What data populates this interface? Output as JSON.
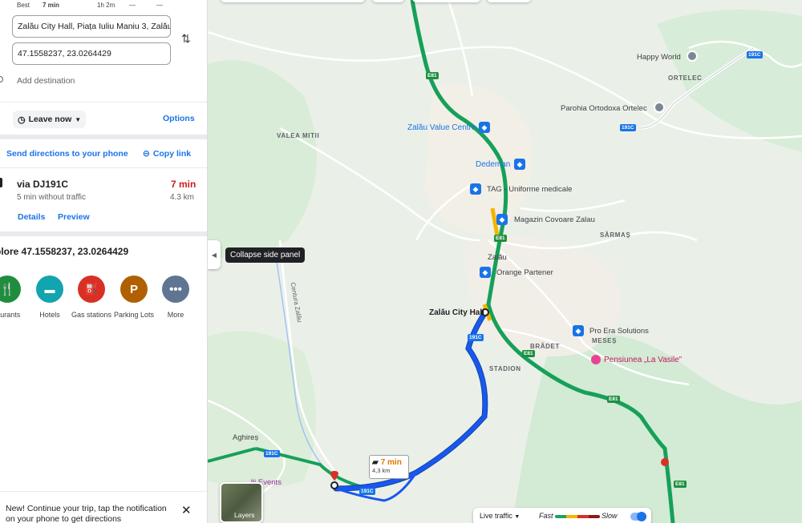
{
  "panel": {
    "modes": [
      {
        "label": "Best"
      },
      {
        "label": "7 min"
      },
      {
        "label": "1h 2m"
      },
      {
        "label": "—"
      },
      {
        "label": "—"
      }
    ],
    "origin_value": "Zalău City Hall, Piața Iuliu Maniu 3, Zalău",
    "destination_value": "47.1558237, 23.0264429",
    "add_destination": "Add destination",
    "leave_now": "Leave now",
    "options": "Options",
    "send_directions": "Send directions to your phone",
    "copy_link": "Copy link",
    "route": {
      "via": "via DJ191C",
      "time": "7 min",
      "without_traffic": "5 min without traffic",
      "distance": "4.3 km",
      "details": "Details",
      "preview": "Preview"
    },
    "explore_title": "plore 47.1558237, 23.0264429",
    "poi": [
      {
        "label": "taurants",
        "icon": "fork-knife-icon",
        "color": "#1e8e3e"
      },
      {
        "label": "Hotels",
        "icon": "bed-icon",
        "color": "#12a4af"
      },
      {
        "label": "Gas stations",
        "icon": "gas-pump-icon",
        "color": "#d93025"
      },
      {
        "label": "Parking Lots",
        "icon": "parking-icon",
        "color": "#b06000"
      },
      {
        "label": "More",
        "icon": "more-icon",
        "color": "#5f7591"
      }
    ],
    "notification": "New! Continue your trip, tap the notification on your phone to get directions"
  },
  "map": {
    "tooltip": "Collapse side panel",
    "labels": {
      "happy_world": "Happy World",
      "ortelec": "ORTELEC",
      "parohia": "Parohia Ortodoxa Ortelec",
      "valea_mitii": "VALEA MITII",
      "value_centre": "Zalău Value Centre",
      "dedeman": "Dedeman",
      "tag": "TAG - Uniforme medicale",
      "magazin": "Magazin Covoare Zalau",
      "sarmas": "SĂRMAȘ",
      "zalau": "Zalău",
      "orange": "Orange Partener",
      "city_hall": "Zalău City Hall",
      "pro_era": "Pro Era Solutions",
      "meses": "MESEȘ",
      "bradet": "BRĂDET",
      "pensiunea": "Pensiunea „La Vasile”",
      "stadion": "STADION",
      "centura": "Centura Zalău",
      "aghires": "Aghireș",
      "events": "...lli Events"
    },
    "shields": {
      "e81": "E81",
      "r191c": "191C"
    },
    "eta": {
      "time": "7 min",
      "distance": "4,3 km"
    },
    "layers": "Layers",
    "traffic": {
      "label": "Live traffic",
      "fast": "Fast",
      "slow": "Slow"
    },
    "colors": {
      "route": "#1a56f0",
      "traffic_fast": "#1aa260",
      "traffic_slow": "#d93025"
    }
  }
}
